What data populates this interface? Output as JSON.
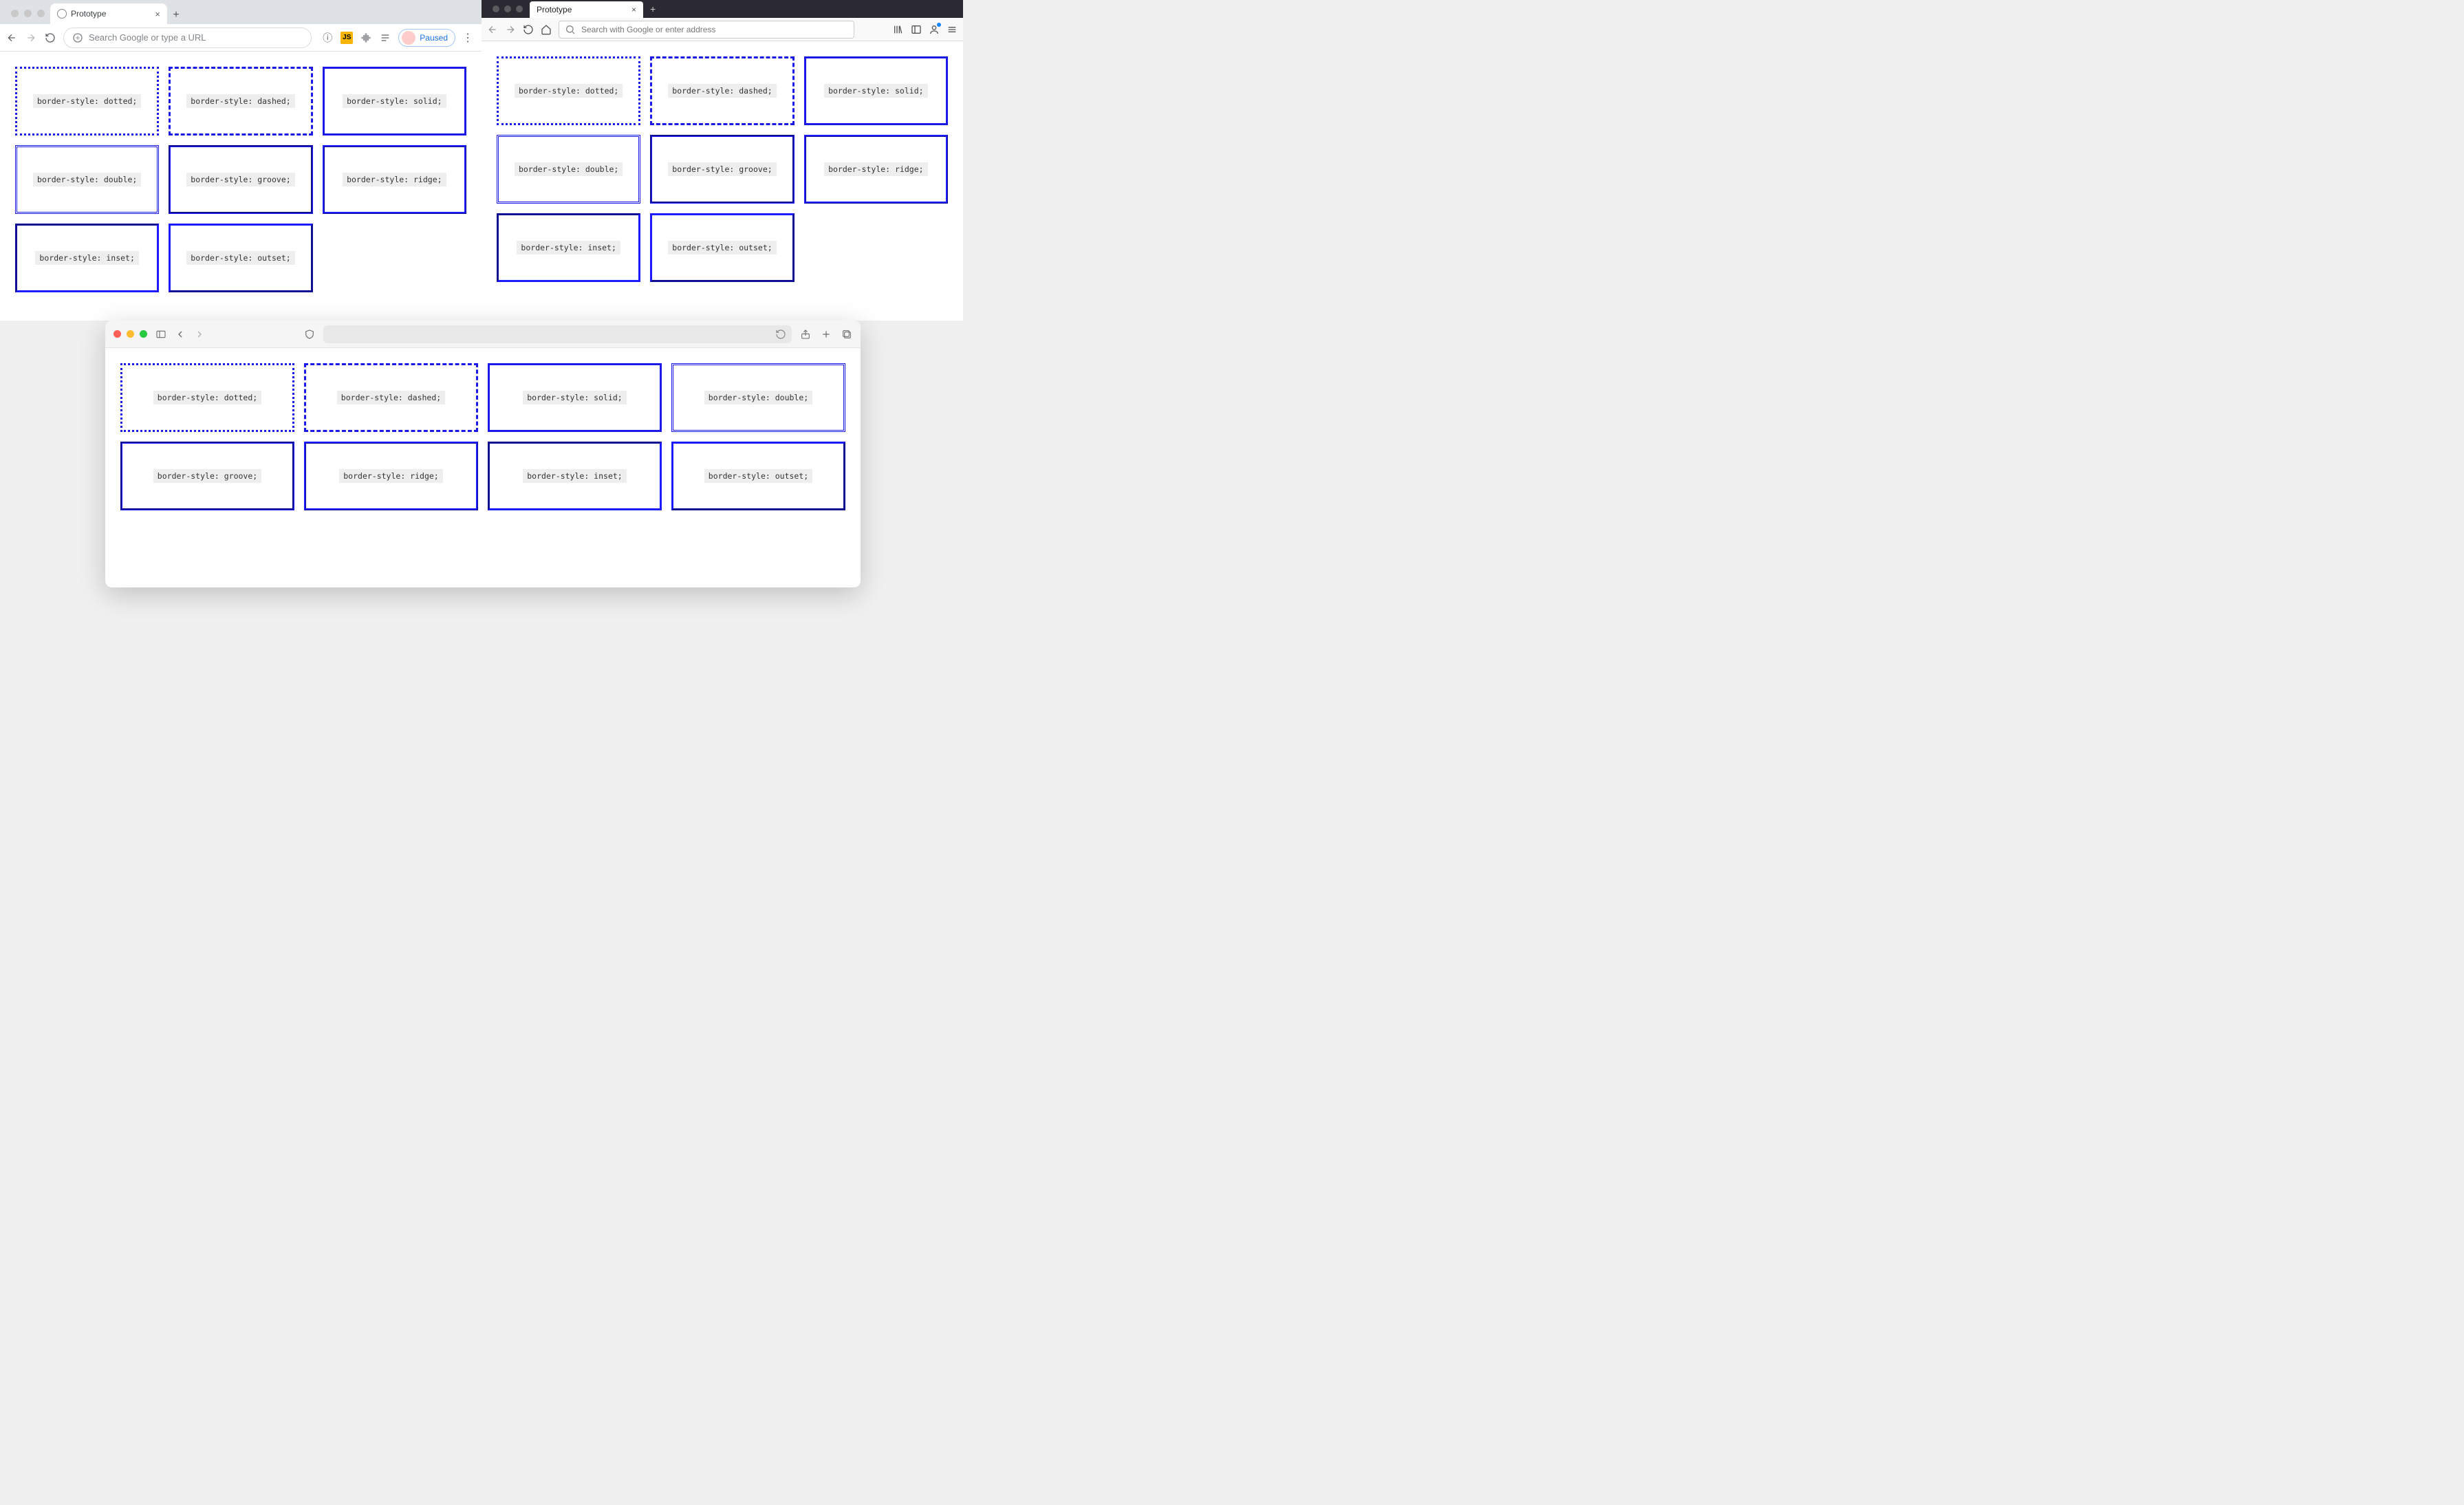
{
  "chrome": {
    "tab_title": "Prototype",
    "url_placeholder": "Search Google or type a URL",
    "paused_label": "Paused"
  },
  "firefox": {
    "tab_title": "Prototype",
    "url_placeholder": "Search with Google or enter address"
  },
  "safari": {},
  "border_color": "#1a19e8",
  "cards": {
    "3col": [
      "border-style: dotted;",
      "border-style: dashed;",
      "border-style: solid;",
      "border-style: double;",
      "border-style: groove;",
      "border-style: ridge;",
      "border-style: inset;",
      "border-style: outset;"
    ],
    "4col": [
      "border-style: dotted;",
      "border-style: dashed;",
      "border-style: solid;",
      "border-style: double;",
      "border-style: groove;",
      "border-style: ridge;",
      "border-style: inset;",
      "border-style: outset;"
    ]
  }
}
